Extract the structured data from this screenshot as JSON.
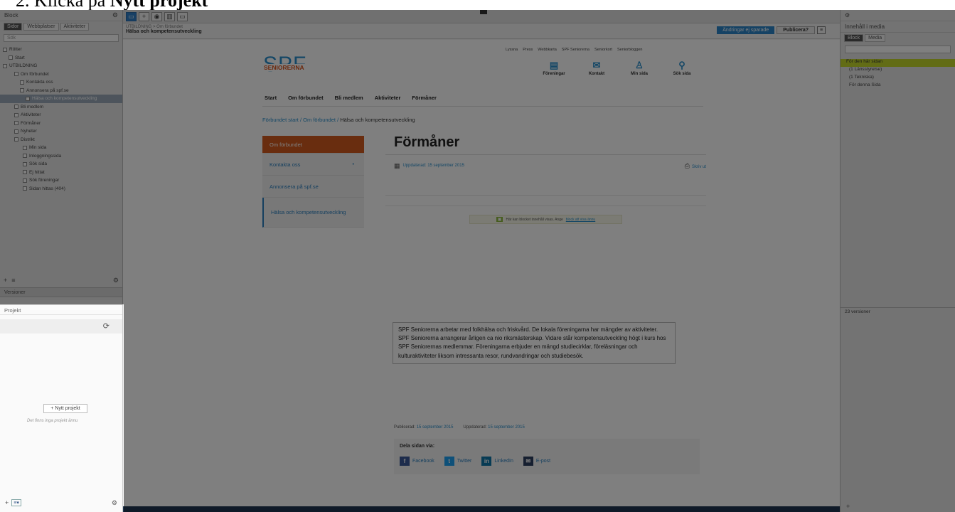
{
  "heading": {
    "num": "2.",
    "prefix": "Klicka på",
    "bold": "Nytt projekt"
  },
  "left": {
    "title": "Block",
    "search": "Sök",
    "tabs": [
      "Sidor",
      "Webbplatser",
      "Aktiviteter"
    ],
    "tree": [
      "Rötter",
      "Start",
      "UTBILDNING",
      "Om förbundet",
      "Kontakta oss",
      "Annonsera på spf.se",
      "Hälsa och kompetensutveckling",
      "Bli medlem",
      "Aktiviteter",
      "Förmåner",
      "Nyheter",
      "Distrikt",
      "Min sida",
      "Inloggningssida",
      "Sök sida",
      "Ej hittat",
      "Sök föreningar",
      "Sidan hittas (404)"
    ],
    "versions": "Versioner"
  },
  "projekt": {
    "title": "Projekt",
    "new_button": "+ Nytt projekt",
    "empty": "Det finns inga projekt ännu"
  },
  "center": {
    "crumb_small": "UTBILDNING > Om förbundet",
    "crumb_big": "Hälsa och kompetensutveckling",
    "btn_draft": "Ändringar ej sparade",
    "btn_publish": "Publicera?"
  },
  "site": {
    "top_links": [
      "Lyssna",
      "Press",
      "Webbkarta",
      "SPF Seniorerna",
      "Seniorkort",
      "Seniorbloggen"
    ],
    "logo_main": "SPF",
    "logo_sub": "SENIORERNA",
    "quick": [
      {
        "icon": "▤",
        "label": "Föreningar"
      },
      {
        "icon": "✉",
        "label": "Kontakt"
      },
      {
        "icon": "♙",
        "label": "Min sida"
      },
      {
        "icon": "⚲",
        "label": "Sök sida"
      }
    ],
    "nav": [
      "Start",
      "Om förbundet",
      "Bli medlem",
      "Aktiviteter",
      "Förmåner"
    ],
    "crumbs": {
      "a": "Förbundet start",
      "sep": " / ",
      "b": "Om förbundet",
      "cur": "Hälsa och kompetensutveckling"
    },
    "subnav": [
      "Om förbundet",
      "Kontakta oss",
      "Annonsera på spf.se",
      "Hälsa och kompetensutveckling"
    ],
    "title": "Förmåner",
    "updated": "Uppdaterad: 15 september 2015",
    "print": "Skriv ut",
    "notice_text": "Här kan blocket innehåll visas. Ange",
    "notice_link": "block att visa ännu",
    "body": "SPF Seniorerna arbetar med folkhälsa och friskvård. De lokala föreningarna har mängder av aktiviteter. SPF Seniorerna arrangerar årligen ca nio riksmästerskap. Vidare står kompetensutveckling högt i kurs hos SPF Seniorernas medlemmar. Föreningarna erbjuder en mängd studiecirklar, föreläsningar och kulturaktiviteter liksom intressanta resor, rundvandringar och studiebesök.",
    "published_label": "Publicerad:",
    "published": "15 september 2015",
    "updated_label": "Uppdaterad:",
    "updated2": "15 september 2015",
    "share_title": "Dela sidan via:",
    "share": [
      "Facebook",
      "Twitter",
      "LinkedIn",
      "E-post"
    ]
  },
  "right": {
    "title": "Innehåll i media",
    "tabs": [
      "Block",
      "Media"
    ],
    "tree": [
      "För den här sidan",
      "(1 Länsstyrelse)",
      "(1 Tekniska)",
      "För denna Sida"
    ],
    "version": "23 versioner"
  }
}
